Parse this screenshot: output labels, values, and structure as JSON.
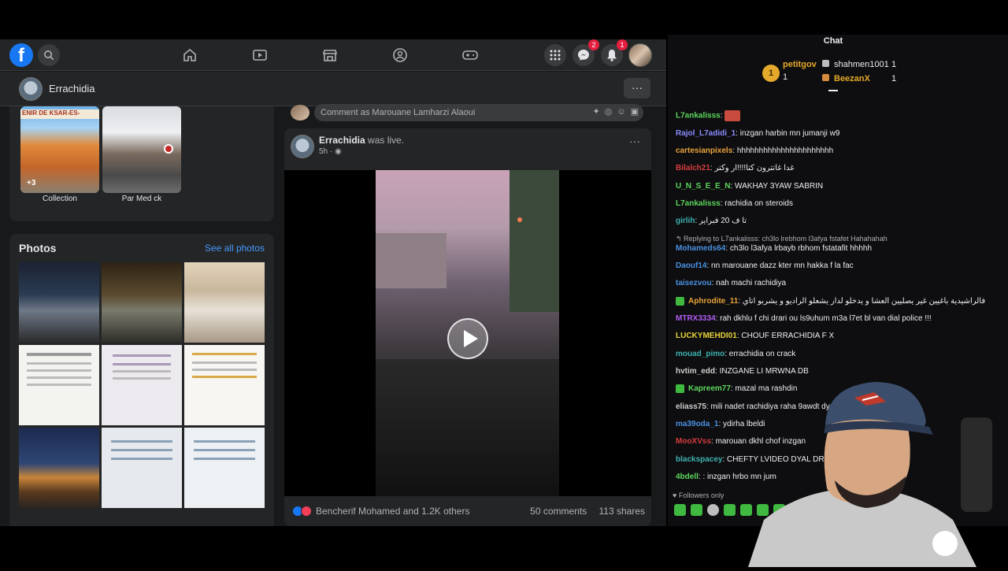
{
  "facebook": {
    "logo": "f",
    "nav_icons": [
      "home-icon",
      "watch-icon",
      "marketplace-icon",
      "groups-icon",
      "gaming-icon"
    ],
    "badges": {
      "messenger": "2",
      "notifications": "1"
    },
    "page_name": "Errachidia",
    "page_more": "···",
    "albums": [
      {
        "label": "Collection",
        "overlay": "+3",
        "sign_text": "ENIR DE KSAR-ES-"
      },
      {
        "label": "Par Med ck"
      }
    ],
    "photos": {
      "title": "Photos",
      "see_all": "See all photos"
    },
    "comment_placeholder": "Comment as Marouane Lamharzi Alaoui",
    "post": {
      "author": "Errachidia",
      "action": " was live.",
      "time": "5h · ",
      "more": "···",
      "reactions_text": "Bencherif Mohamed and 1.2K others",
      "comments": "50 comments",
      "shares": "113 shares"
    }
  },
  "chat": {
    "title": "Chat",
    "leaderboard": [
      {
        "rank": "1",
        "name": "petitgov",
        "count": "1"
      },
      {
        "name": "shahmen1001",
        "count": "1"
      },
      {
        "name": "BeezanX",
        "count": "1"
      }
    ],
    "reply_text": "↰ Replying to L7ankalisss: ch3lo lrebhom l3afya fstafet Hahahahah",
    "messages": [
      {
        "user": "L7ankalisss",
        "text": "",
        "color": "#5cd65c"
      },
      {
        "user": "Rajol_L7adidi_1",
        "text": " inzgan harbin mn jumanji w9",
        "color": "#8a8aff"
      },
      {
        "user": "cartesianpixels",
        "text": " hhhhhhhhhhhhhhhhhhhhhh",
        "color": "#e8a23a"
      },
      {
        "user": "Bilalch21",
        "text": " غدا غاتترون كتا!!!!ار وكتر",
        "color": "#d43d3d"
      },
      {
        "user": "U_N_S_E_E_N",
        "text": " WAKHAY 3YAW SABRIN",
        "color": "#5cd65c"
      },
      {
        "user": "L7ankalisss",
        "text": " rachidia on steroids",
        "color": "#5cd65c"
      },
      {
        "user": "girlih",
        "text": " تا ف 20 فبراير",
        "color": "#3fb0b0"
      },
      {
        "user": "Mohameds64",
        "text": " ch3lo l3afya lrbayb rbhom fstatafit hhhhh",
        "color": "#4a90e2"
      },
      {
        "user": "Daouf14",
        "text": " nn marouane dazz kter mn hakka f la fac",
        "color": "#4a90e2"
      },
      {
        "user": "taisezvou",
        "text": " nah machi rachidiya",
        "color": "#4a90e2"
      },
      {
        "user": "Aphrodite_11",
        "text": " فالراشيدية باغيين غير يصليين العشا و يدخلو لدار يشعلو الراديو و يشربو اتاي",
        "color": "#e8a23a"
      },
      {
        "user": "MTRX3334",
        "text": " rah dkhlu f chi drari ou ls9uhum m3a l7et bl van dial police !!!",
        "color": "#b05cf0"
      },
      {
        "user": "LUCKYMEHDI01",
        "text": " CHOUF ERRACHIDIA F X",
        "color": "#e8d23a"
      },
      {
        "user": "mouad_pimo",
        "text": " errachidia on crack",
        "color": "#3fb0b0"
      },
      {
        "user": "hvtim_edd",
        "text": " INZGANE LI MRWNA DB",
        "color": "#cfcfcf"
      },
      {
        "user": "Kapreem77",
        "text": " mazal ma rashdin",
        "color": "#5cd65c"
      },
      {
        "user": "eliass75",
        "text": " mili nadet rachidiya raha 9awdt dyal",
        "color": "#cfcfcf"
      },
      {
        "user": "ma39oda_1",
        "text": " ydirha lbeldi",
        "color": "#4a90e2"
      },
      {
        "user": "MooXVss",
        "text": " marouan dkhl chof inzgan",
        "color": "#d43d3d"
      },
      {
        "user": "blackspacey",
        "text": " CHEFTY LVIDEO DYAL DR",
        "color": "#3fb0b0"
      },
      {
        "user": "4bdell",
        "text": " : inzgan hrbo mn jum",
        "color": "#5cd65c"
      }
    ],
    "followers_only": "♥ Followers only"
  }
}
